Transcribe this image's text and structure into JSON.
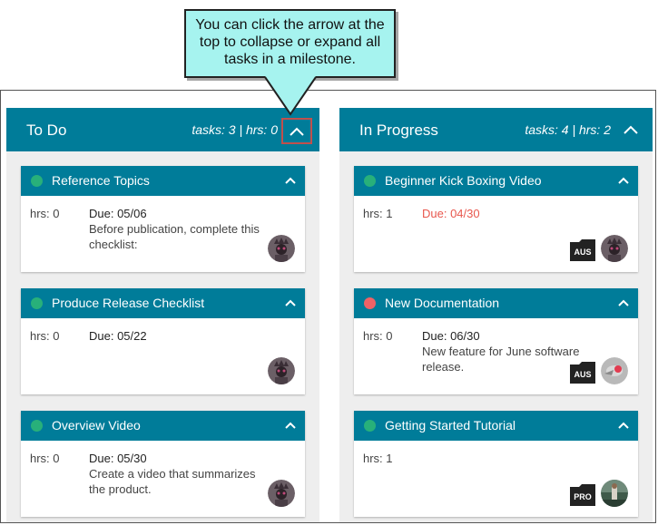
{
  "callout": {
    "text": "You can click the arrow at the top to collapse or expand all tasks in a milestone."
  },
  "colors": {
    "header": "#007c99",
    "status_green": "#28b07a",
    "status_red": "#f06266",
    "overdue": "#e8574d",
    "highlight": "#c0504d",
    "callout_bg": "#a6f3ef"
  },
  "columns": [
    {
      "title": "To Do",
      "stats": "tasks: 3 | hrs: 0",
      "collapse_icon": "chevron-up-icon",
      "cards": [
        {
          "title": "Reference Topics",
          "status": "green",
          "hrs": "hrs: 0",
          "due": "Due: 05/06",
          "desc": "Before publication, complete this checklist:",
          "badge": "",
          "avatar": "user-avatar"
        },
        {
          "title": "Produce Release Checklist",
          "status": "green",
          "hrs": "hrs: 0",
          "due": "Due: 05/22",
          "desc": "",
          "badge": "",
          "avatar": "user-avatar"
        },
        {
          "title": "Overview Video",
          "status": "green",
          "hrs": "hrs: 0",
          "due": "Due: 05/30",
          "desc": "Create a video that summarizes the product.",
          "badge": "",
          "avatar": "user-avatar"
        }
      ]
    },
    {
      "title": "In Progress",
      "stats": "tasks: 4 | hrs: 2",
      "collapse_icon": "chevron-up-icon",
      "cards": [
        {
          "title": "Beginner Kick Boxing Video",
          "status": "green",
          "hrs": "hrs: 1",
          "due": "Due: 04/30",
          "overdue": true,
          "desc": "",
          "badge": "AUS",
          "avatar": "user-avatar"
        },
        {
          "title": "New Documentation",
          "status": "red",
          "hrs": "hrs: 0",
          "due": "Due: 06/30",
          "desc": "New feature for June software release.",
          "badge": "AUS",
          "avatar": "user-avatar"
        },
        {
          "title": "Getting Started Tutorial",
          "status": "green",
          "hrs": "hrs: 1",
          "due": "",
          "desc": "",
          "badge": "PRO",
          "avatar": "user-avatar"
        }
      ]
    }
  ]
}
